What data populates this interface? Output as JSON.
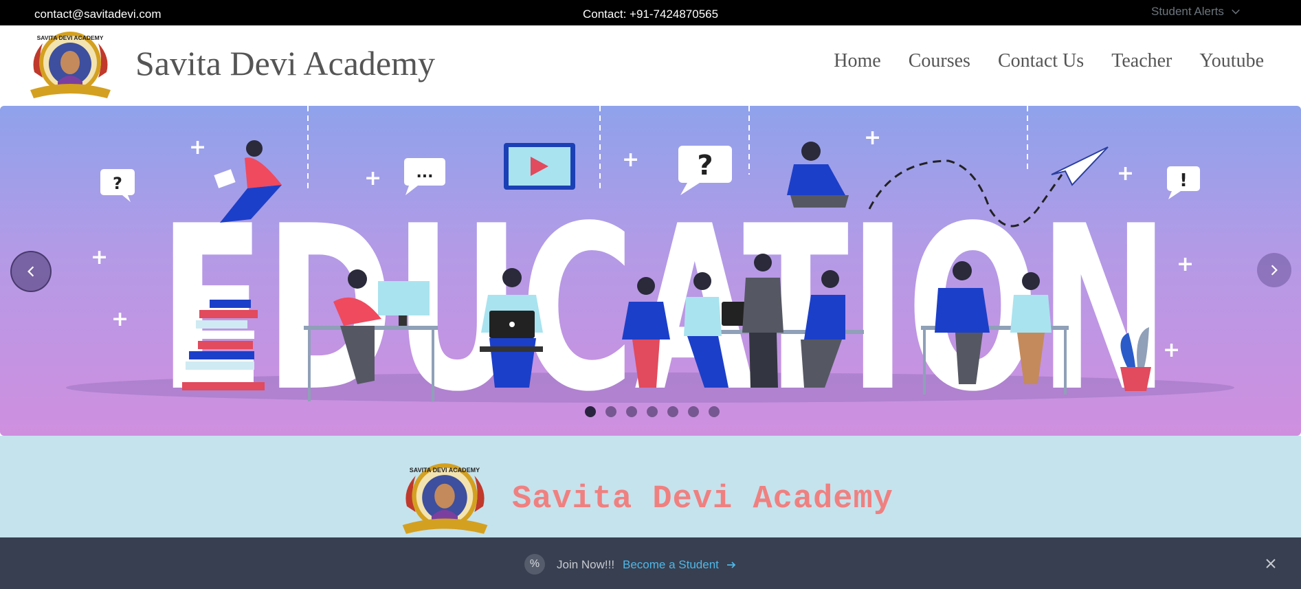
{
  "topbar": {
    "email": "contact@savitadevi.com",
    "phone": "Contact: +91-7424870565",
    "alerts_label": "Student Alerts",
    "alerts_icon": "chevron-down-icon"
  },
  "header": {
    "brand": "Savita Devi Academy",
    "logo_text": "SAVITA DEVI ACADEMY",
    "nav": [
      "Home",
      "Courses",
      "Contact Us",
      "Teacher",
      "Youtube"
    ]
  },
  "carousel": {
    "banner_word": "EDUCATION",
    "slide_count": 7,
    "active_slide": 1,
    "prev_icon": "chevron-left-icon",
    "next_icon": "chevron-right-icon"
  },
  "info": {
    "title": "Savita Devi Academy"
  },
  "banner": {
    "badge": "%",
    "join_text": "Join Now!!!",
    "link_text": "Become a Student",
    "link_icon": "arrow-right-icon",
    "close_icon": "close-icon",
    "accent": "#4fb8e8",
    "background": "#373f50"
  },
  "colors": {
    "topbar_bg": "#000000",
    "info_bg": "#c5e3ed",
    "info_title": "#f08080"
  }
}
